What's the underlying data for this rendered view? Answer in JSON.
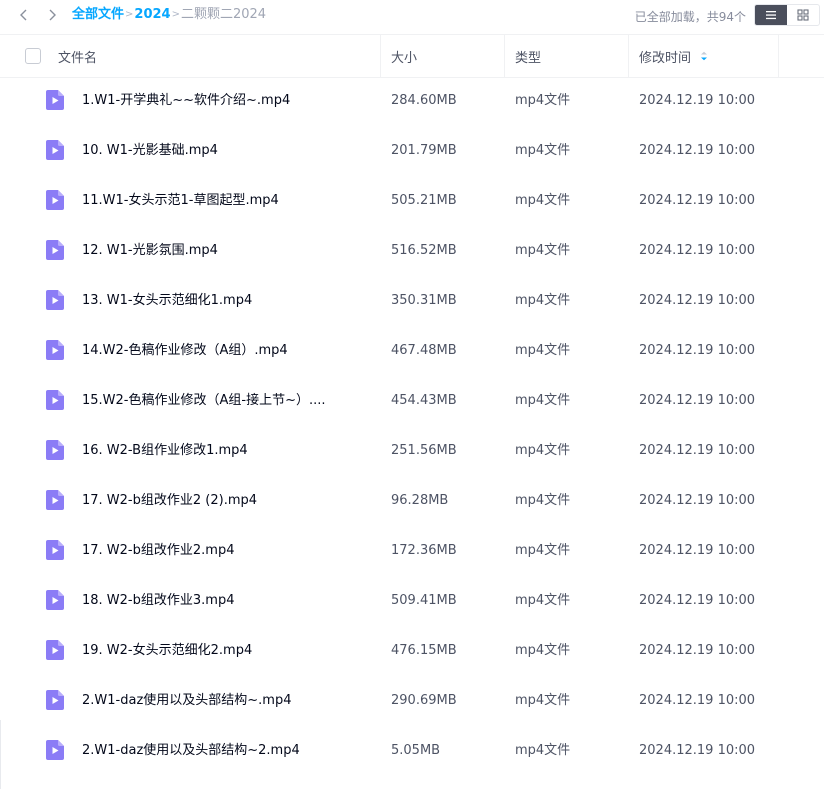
{
  "breadcrumb": {
    "items": [
      "全部文件",
      "2024"
    ],
    "current": "二颗颗二2024"
  },
  "load_status": "已全部加载，共94个",
  "icons": {
    "back": "chevron-left-icon",
    "forward": "chevron-right-icon",
    "list_view": "list-view-icon",
    "grid_view": "grid-view-icon",
    "file": "video-file-icon",
    "sort": "sort-desc-icon"
  },
  "colors": {
    "accent": "#06a7ff",
    "file_icon": "#8b7cf6",
    "active_toggle": "#4b4f5c"
  },
  "columns": {
    "name": "文件名",
    "size": "大小",
    "type": "类型",
    "modified": "修改时间"
  },
  "files": [
    {
      "name": "1.W1-开学典礼~~软件介绍~.mp4",
      "size": "284.60MB",
      "type": "mp4文件",
      "modified": "2024.12.19 10:00"
    },
    {
      "name": "10. W1-光影基础.mp4",
      "size": "201.79MB",
      "type": "mp4文件",
      "modified": "2024.12.19 10:00"
    },
    {
      "name": "11.W1-女头示范1-草图起型.mp4",
      "size": "505.21MB",
      "type": "mp4文件",
      "modified": "2024.12.19 10:00"
    },
    {
      "name": "12. W1-光影氛围.mp4",
      "size": "516.52MB",
      "type": "mp4文件",
      "modified": "2024.12.19 10:00"
    },
    {
      "name": "13. W1-女头示范细化1.mp4",
      "size": "350.31MB",
      "type": "mp4文件",
      "modified": "2024.12.19 10:00"
    },
    {
      "name": "14.W2-色稿作业修改（A组）.mp4",
      "size": "467.48MB",
      "type": "mp4文件",
      "modified": "2024.12.19 10:00"
    },
    {
      "name": "15.W2-色稿作业修改（A组-接上节~）....",
      "size": "454.43MB",
      "type": "mp4文件",
      "modified": "2024.12.19 10:00"
    },
    {
      "name": "16. W2-B组作业修改1.mp4",
      "size": "251.56MB",
      "type": "mp4文件",
      "modified": "2024.12.19 10:00"
    },
    {
      "name": "17. W2-b组改作业2 (2).mp4",
      "size": "96.28MB",
      "type": "mp4文件",
      "modified": "2024.12.19 10:00"
    },
    {
      "name": "17. W2-b组改作业2.mp4",
      "size": "172.36MB",
      "type": "mp4文件",
      "modified": "2024.12.19 10:00"
    },
    {
      "name": "18. W2-b组改作业3.mp4",
      "size": "509.41MB",
      "type": "mp4文件",
      "modified": "2024.12.19 10:00"
    },
    {
      "name": "19. W2-女头示范细化2.mp4",
      "size": "476.15MB",
      "type": "mp4文件",
      "modified": "2024.12.19 10:00"
    },
    {
      "name": "2.W1-daz使用以及头部结构~.mp4",
      "size": "290.69MB",
      "type": "mp4文件",
      "modified": "2024.12.19 10:00"
    },
    {
      "name": "2.W1-daz使用以及头部结构~2.mp4",
      "size": "5.05MB",
      "type": "mp4文件",
      "modified": "2024.12.19 10:00"
    }
  ]
}
